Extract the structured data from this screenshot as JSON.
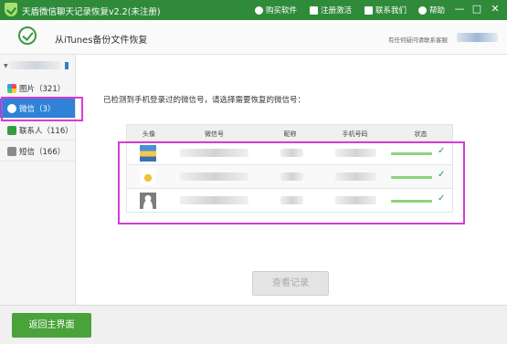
{
  "window": {
    "title": "天盾微信聊天记录恢复v2.2(未注册)",
    "links": [
      "购买软件",
      "注册激活",
      "联系我们",
      "帮助"
    ],
    "controls": [
      "—",
      "□",
      "✕"
    ]
  },
  "header": {
    "title": "从iTunes备份文件恢复",
    "help_text": "有任何疑问请联系客服"
  },
  "sidebar": {
    "items": [
      {
        "label": "图片（321）",
        "icon": "photos-icon"
      },
      {
        "label": "微信（3）",
        "icon": "wechat-icon",
        "active": true
      },
      {
        "label": "联系人（116）",
        "icon": "contacts-icon"
      },
      {
        "label": "短信（166）",
        "icon": "sms-icon"
      }
    ]
  },
  "main": {
    "notice": "已检测到手机登录过的微信号，请选择需要恢复的微信号：",
    "table": {
      "columns": [
        "头像",
        "微信号",
        "昵称",
        "手机号码",
        "状态"
      ],
      "rows": [
        {
          "status_icon": "check-icon"
        },
        {
          "status_icon": "check-icon"
        },
        {
          "status_icon": "check-icon"
        }
      ]
    },
    "view_button": "查看记录"
  },
  "footer": {
    "back_button": "返回主界面"
  },
  "colors": {
    "titlebar": "#2f8a3a",
    "active": "#2f82d6",
    "highlight": "#d63cd6",
    "back_button": "#4aa23a"
  }
}
